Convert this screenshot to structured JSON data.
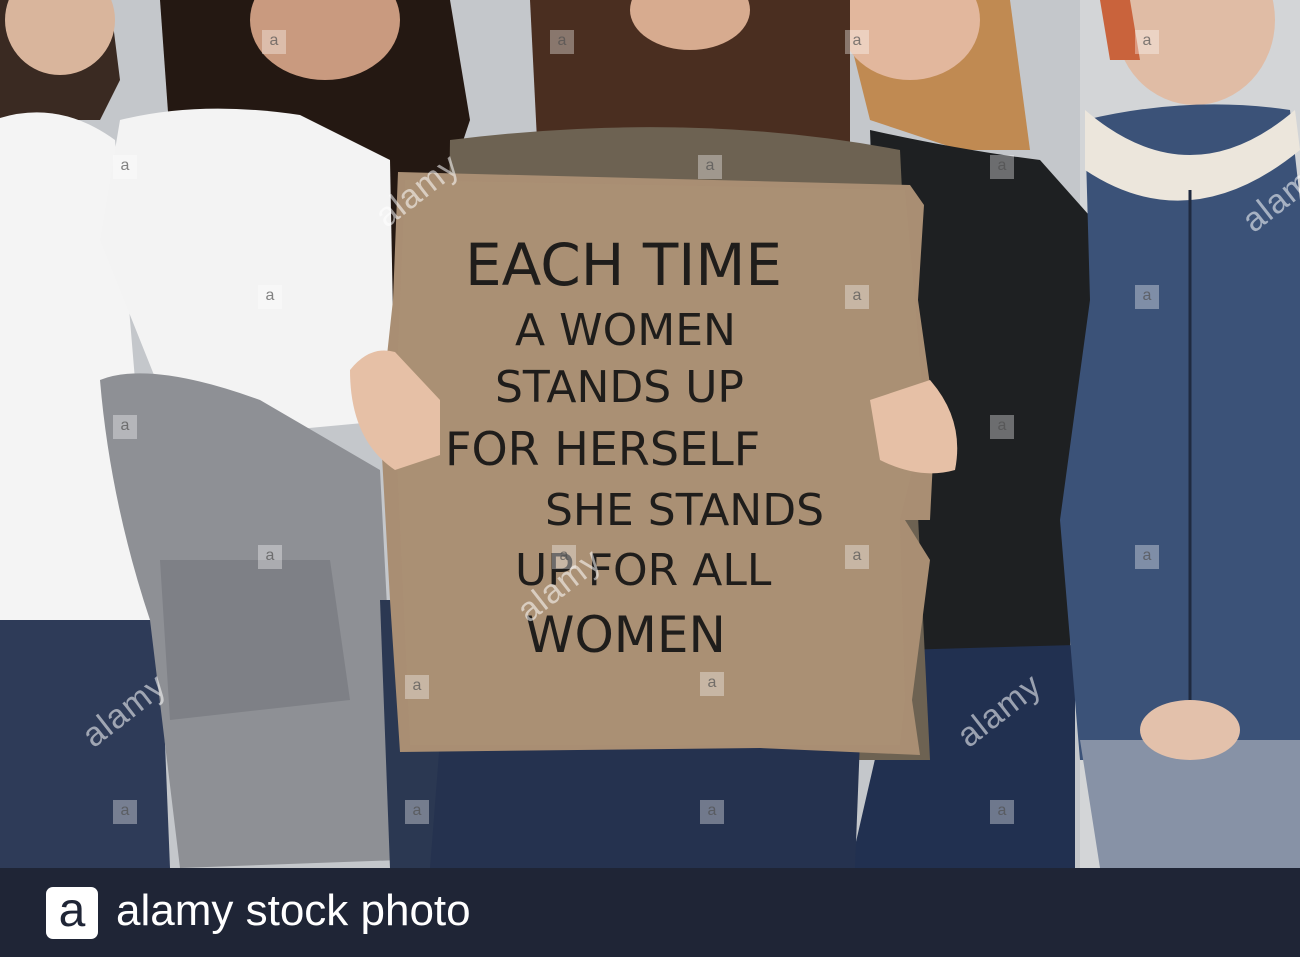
{
  "image": {
    "sign_lines": [
      "EACH TIME",
      "A WOMEN",
      "STANDS UP",
      "FOR HERSELF",
      "SHE STANDS",
      "UP FOR ALL",
      "WOMEN"
    ]
  },
  "watermark": {
    "mark": "a",
    "word": "alamy"
  },
  "footer": {
    "logo_letter": "a",
    "text": "alamy stock photo"
  },
  "colors": {
    "footer_bg": "#1f2536",
    "cardboard": "#a98e73",
    "ink": "#1f1d1b"
  }
}
